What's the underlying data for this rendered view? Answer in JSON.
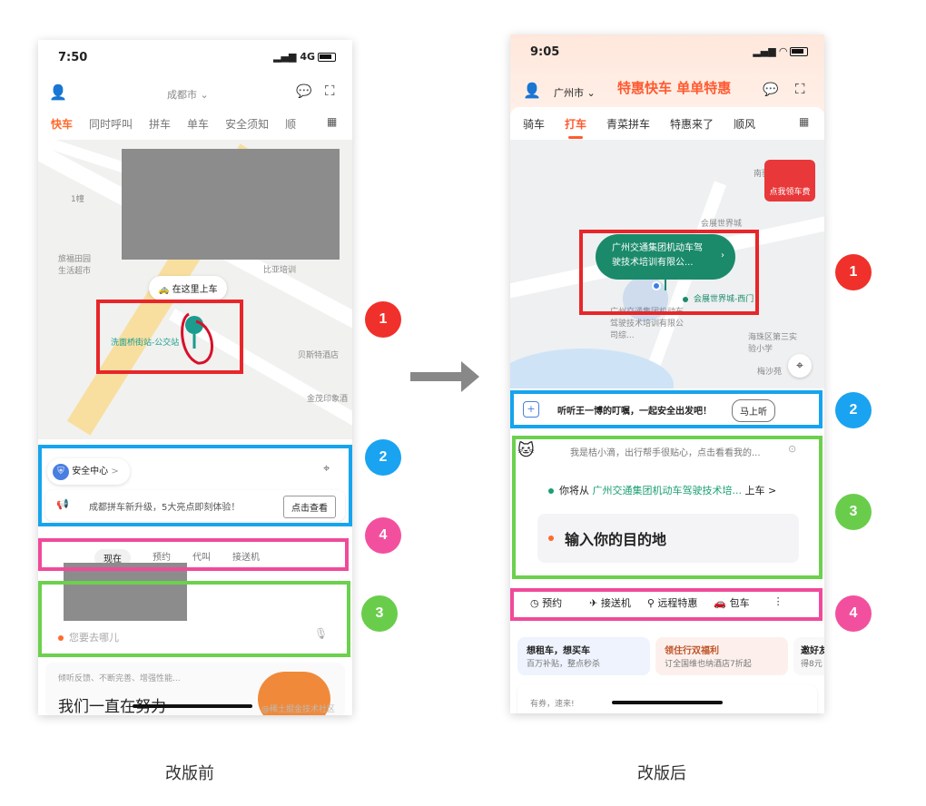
{
  "captions": {
    "before": "改版前",
    "after": "改版后"
  },
  "badges": [
    "1",
    "2",
    "3",
    "4"
  ],
  "left": {
    "status": {
      "time": "7:50",
      "network": "4G"
    },
    "city": "成都市",
    "tabs": [
      "快车",
      "同时呼叫",
      "拼车",
      "单车",
      "安全须知",
      "顺"
    ],
    "map_labels": {
      "pickup_chip": "在这里上车",
      "station": "洗面桥街站-公交站",
      "store": "旅福田园 生活超市",
      "building_a": "1幢",
      "poi_hotel": "贝斯特酒店",
      "poi_shop": "金茂印象酒",
      "poi_area": "比亚培训"
    },
    "safety": {
      "title": "安全中心",
      "chevron": ">"
    },
    "notice": {
      "text": "成都拼车新升级，5大亮点即刻体验！",
      "button": "点击查看"
    },
    "time_tabs": [
      "现在",
      "预约",
      "代叫",
      "接送机"
    ],
    "destination_placeholder": "您要去哪儿",
    "bottom": {
      "sub": "倾听反馈、不断完善、增强性能...",
      "title": "我们一直在努力",
      "watermark": "@稀土掘金技术社区"
    }
  },
  "right": {
    "status": {
      "time": "9:05"
    },
    "city": "广州市",
    "banner_text": "特惠快车 单单特惠",
    "tabs": [
      "骑车",
      "打车",
      "青菜拼车",
      "特惠来了",
      "顺风"
    ],
    "pickup_bubble": "广州交通集团机动车驾驶技术培训有限公...",
    "map_labels": {
      "place_a": "会展世界城-西门",
      "place_b": "广州交通集团机动车驾驶技术培训有限公司综...",
      "school": "海珠区第三实验小学",
      "gate": "梅沙苑",
      "road": "南驰",
      "world": "会展世界城"
    },
    "red_packet": "点我领车费",
    "safety_text": "听听王一博的叮嘱，一起安全出发吧！",
    "safety_button": "马上听",
    "assistant_text": "我是桔小滴，出行帮手很贴心，点击看看我的...",
    "from_prefix": "你将从",
    "from_place": "广州交通集团机动车驾驶技术培...",
    "from_suffix": "上车 >",
    "destination": "输入你的目的地",
    "services": [
      "预约",
      "接送机",
      "远程特惠",
      "包车"
    ],
    "promos": [
      {
        "title": "想租车，想买车",
        "sub": "百万补贴，整点秒杀"
      },
      {
        "title": "领住行双福利",
        "sub": "订全国维也纳酒店7折起"
      },
      {
        "title": "邀好友",
        "sub": "得8元"
      }
    ],
    "coupon_text": "有券，速来!"
  },
  "colors": {
    "red": "#e8262a",
    "blue": "#16a4ee",
    "pink": "#f04a9a",
    "green": "#6cd04e",
    "accent": "#ff5a30"
  }
}
